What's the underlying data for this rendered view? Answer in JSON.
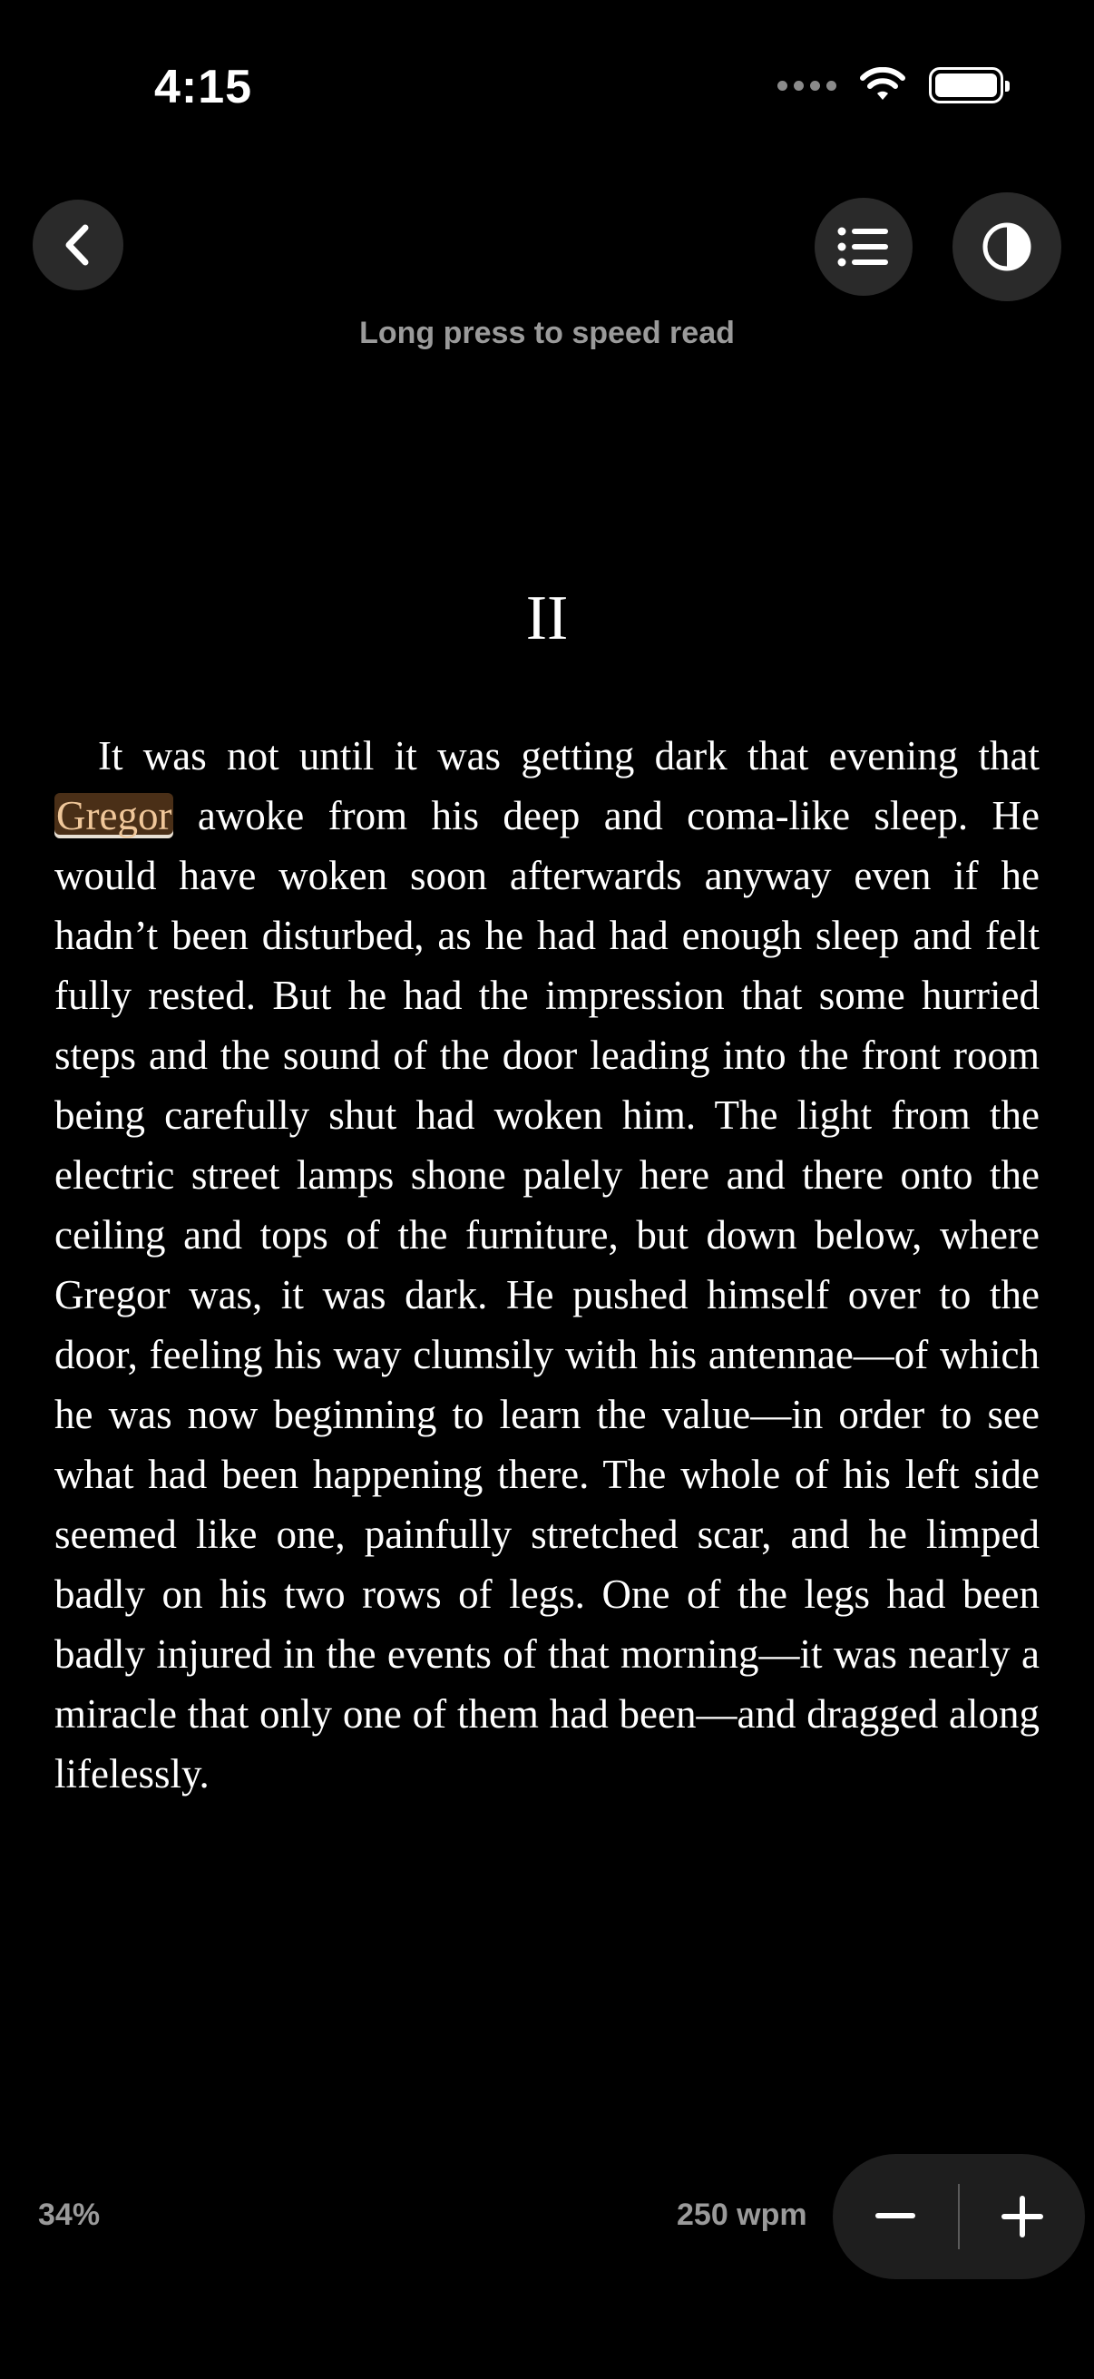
{
  "status_bar": {
    "time": "4:15"
  },
  "header": {
    "hint": "Long press to speed read"
  },
  "reader": {
    "chapter_title": "II",
    "paragraph_before": "It was not until it was getting dark that evening that ",
    "highlighted_word": "Gregor",
    "paragraph_after": " awoke from his deep and coma-like sleep. He would have woken soon afterwards anyway even if he hadn’t been disturbed, as he had had enough sleep and felt fully rested. But he had the impression that some hurried steps and the sound of the door leading into the front room being carefully shut had woken him. The light from the electric street lamps shone palely here and there onto the ceiling and tops of the furniture, but down below, where Gregor was, it was dark. He pushed himself over to the door, feeling his way clumsily with his antennae—of which he was now beginning to learn the value—in order to see what had been happening there. The whole of his left side seemed like one, painfully stretched scar, and he limped badly on his two rows of legs. One of the legs had been badly injured in the events of that morning—it was nearly a miracle that only one of them had been—and dragged along lifelessly."
  },
  "footer": {
    "progress": "34%",
    "speed": "250 wpm"
  },
  "icons": {
    "back": "chevron-left-icon",
    "toc": "list-icon",
    "theme": "contrast-icon",
    "decrease": "minus-icon",
    "increase": "plus-icon"
  },
  "colors": {
    "background": "#000000",
    "highlight_bg": "#4a2f17",
    "highlight_text": "#f0c79a",
    "muted_text": "#9a9a9a"
  }
}
